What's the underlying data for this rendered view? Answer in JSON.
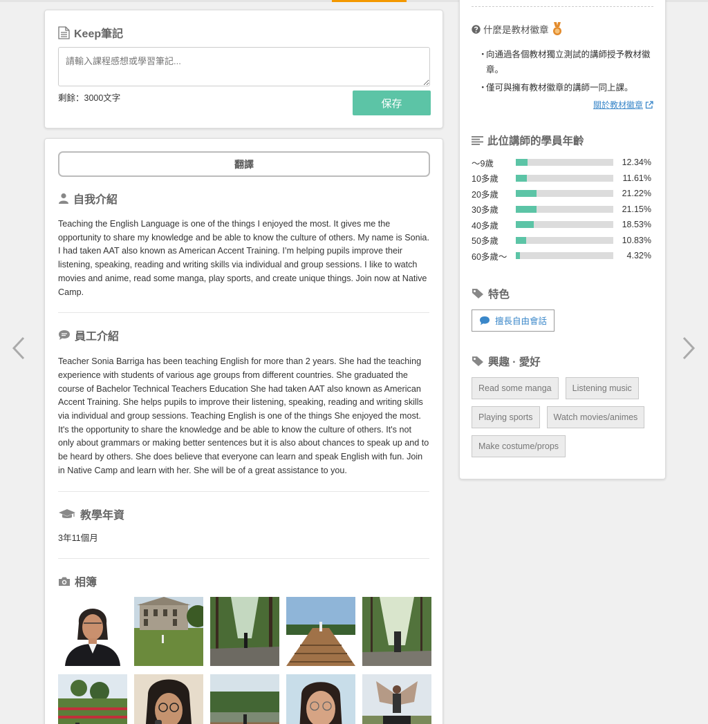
{
  "notes": {
    "title": "Keep筆記",
    "placeholder": "請輸入課程感想或學習筆記...",
    "remaining": "剩餘：3000文字",
    "save_label": "保存"
  },
  "profile": {
    "translate_label": "翻譯",
    "self_intro": {
      "title": "自我介紹",
      "text": "Teaching the English Language is one of the things I enjoyed the most. It gives me the opportunity to share my knowledge and be able to know the culture of others. My name is Sonia. I had taken AAT also known as American Accent Training. I’m helping pupils improve their listening, speaking, reading and writing skills via individual and group sessions. I like to watch movies and anime, read some manga, play sports, and create unique things. Join now at Native Camp."
    },
    "staff_intro": {
      "title": "員工介紹",
      "text": "Teacher Sonia Barriga has been teaching English for more than 2 years. She had the teaching experience with students of various age groups from different countries. She graduated the course of Bachelor Technical Teachers Education She had taken AAT also known as American Accent Training. She helps pupils to improve their listening, speaking, reading and writing skills via individual and group sessions. Teaching English is one of the things She enjoyed the most. It's the opportunity to share the knowledge and be able to know the culture of others. It's not only about grammars or making better sentences but it is also about chances to speak up and to be heard by others. She does believe that everyone can learn and speak English with fun. Join in Native Camp and learn with her. She will be of a great assistance to you."
    },
    "experience": {
      "title": "教學年資",
      "value": "3年11個月"
    },
    "album": {
      "title": "相簿"
    }
  },
  "badge": {
    "question": "什麼是教材徽章",
    "items": [
      "向通過各個教材獨立測試的講師授予教材徽章。",
      "僅可與擁有教材徽章的講師一同上課。"
    ],
    "about_link": "關於教材徽章"
  },
  "ages": {
    "title": "此位講師的學員年齡",
    "rows": [
      {
        "label": "～9歲",
        "pct": "12.34%",
        "value": 12.34
      },
      {
        "label": "10多歲",
        "pct": "11.61%",
        "value": 11.61
      },
      {
        "label": "20多歲",
        "pct": "21.22%",
        "value": 21.22
      },
      {
        "label": "30多歲",
        "pct": "21.15%",
        "value": 21.15
      },
      {
        "label": "40多歲",
        "pct": "18.53%",
        "value": 18.53
      },
      {
        "label": "50多歲",
        "pct": "10.83%",
        "value": 10.83
      },
      {
        "label": "60多歲～",
        "pct": "4.32%",
        "value": 4.32
      }
    ]
  },
  "features": {
    "title": "特色",
    "tag": "擅長自由會話"
  },
  "hobbies": {
    "title": "興趣 · 愛好",
    "items": [
      "Read some manga",
      "Listening music",
      "Playing sports",
      "Watch movies/animes",
      "Make costume/props"
    ]
  },
  "colors": {
    "accent": "#5cc4a6",
    "link": "#3a87c9",
    "top_accent": "#f39800",
    "badge": "#e38b2c"
  }
}
